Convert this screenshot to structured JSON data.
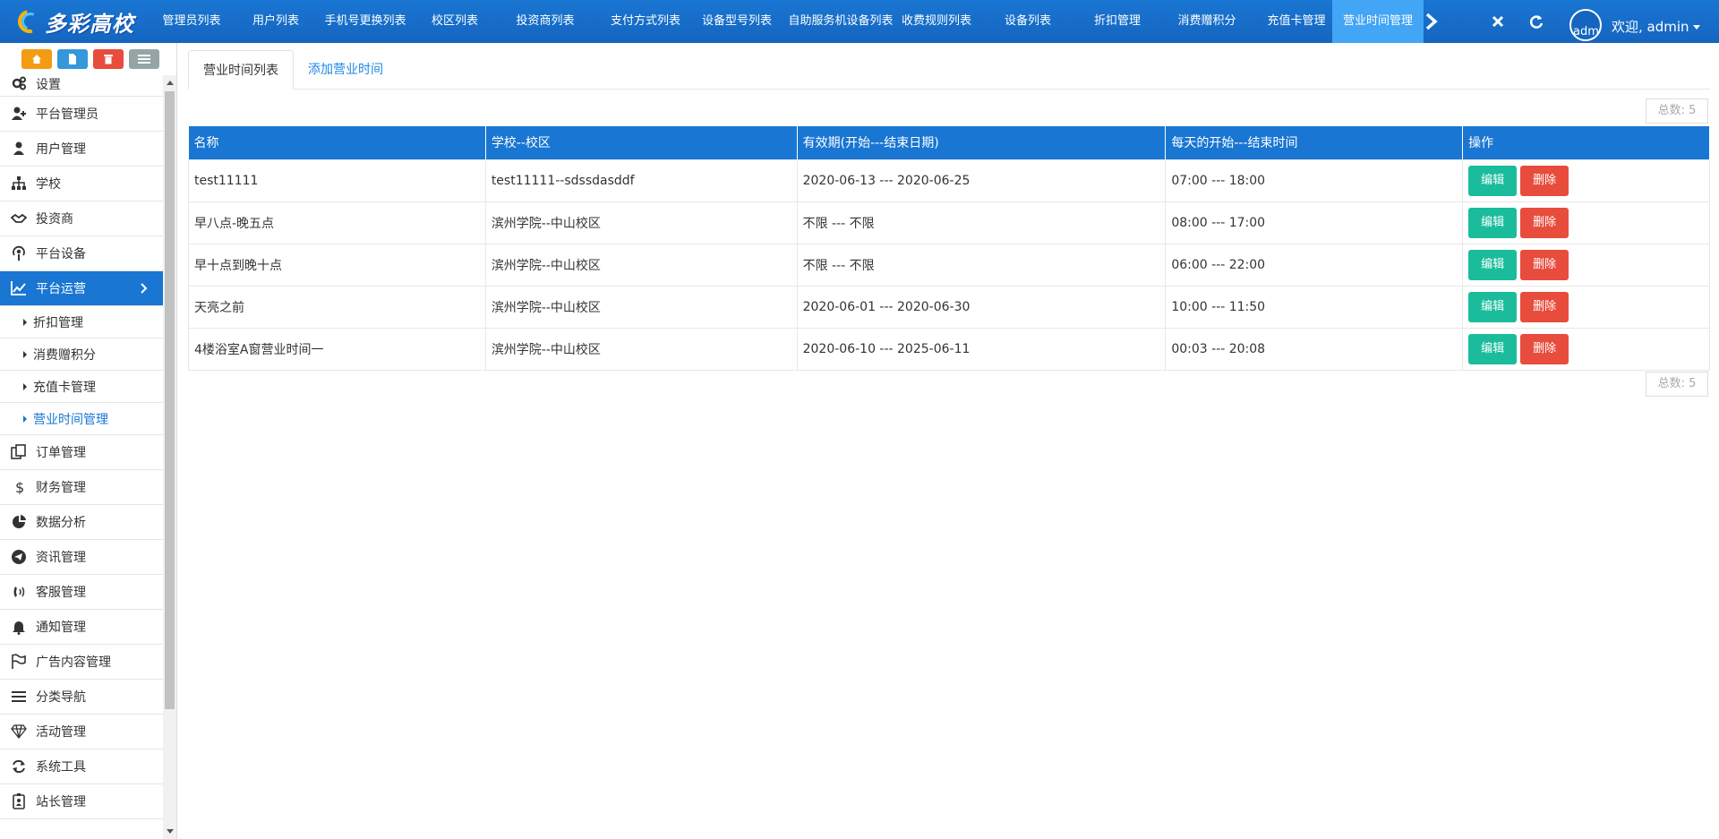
{
  "header": {
    "logo_text": "多彩高校",
    "nav": [
      {
        "label": "管理员列表",
        "w": 108
      },
      {
        "label": "用户列表",
        "w": 80
      },
      {
        "label": "手机号更换列表",
        "w": 120
      },
      {
        "label": "校区列表",
        "w": 80
      },
      {
        "label": "投资商列表",
        "w": 122
      },
      {
        "label": "支付方式列表",
        "w": 102
      },
      {
        "label": "设备型号列表",
        "w": 102
      },
      {
        "label": "自助服务机设备列表",
        "w": 130
      },
      {
        "label": "收费规则列表",
        "w": 84
      },
      {
        "label": "设备列表",
        "w": 120
      },
      {
        "label": "折扣管理",
        "w": 80
      },
      {
        "label": "消费赠积分",
        "w": 120
      },
      {
        "label": "充值卡管理",
        "w": 80
      },
      {
        "label": "营业时间管理",
        "w": 102,
        "active": true
      }
    ],
    "avatar_alt": "admin",
    "welcome": "欢迎, admin"
  },
  "sidebar": {
    "items": [
      {
        "label": "设置",
        "icon": "cogs-icon"
      },
      {
        "label": "平台管理员",
        "icon": "user-plus-icon"
      },
      {
        "label": "用户管理",
        "icon": "user-icon"
      },
      {
        "label": "学校",
        "icon": "sitemap-icon"
      },
      {
        "label": "投资商",
        "icon": "handshake-icon"
      },
      {
        "label": "平台设备",
        "icon": "podcast-icon"
      },
      {
        "label": "平台运营",
        "icon": "line-chart-icon",
        "active": true
      },
      {
        "label": "订单管理",
        "icon": "copy-icon"
      },
      {
        "label": "财务管理",
        "icon": "dollar-icon"
      },
      {
        "label": "数据分析",
        "icon": "pie-chart-icon"
      },
      {
        "label": "资讯管理",
        "icon": "telegram-icon"
      },
      {
        "label": "客服管理",
        "icon": "volume-control-phone-icon"
      },
      {
        "label": "通知管理",
        "icon": "bell-icon"
      },
      {
        "label": "广告内容管理",
        "icon": "flag-icon"
      },
      {
        "label": "分类导航",
        "icon": "bars-icon"
      },
      {
        "label": "活动管理",
        "icon": "diamond-icon"
      },
      {
        "label": "系统工具",
        "icon": "refresh-icon"
      },
      {
        "label": "站长管理",
        "icon": "id-badge-icon"
      }
    ],
    "subitems": [
      {
        "label": "折扣管理"
      },
      {
        "label": "消费赠积分"
      },
      {
        "label": "充值卡管理"
      },
      {
        "label": "营业时间管理",
        "active": true
      }
    ]
  },
  "content": {
    "tabs": {
      "list": "营业时间列表",
      "add": "添加营业时间"
    },
    "total": "总数: 5",
    "columns": [
      "名称",
      "学校--校区",
      "有效期(开始---结束日期)",
      "每天的开始---结束时间",
      "操作"
    ],
    "rows": [
      [
        "test11111",
        "test11111--sdssdasddf",
        "2020-06-13 --- 2020-06-25",
        "07:00 --- 18:00"
      ],
      [
        "早八点-晚五点",
        "滨州学院--中山校区",
        "不限 --- 不限",
        "08:00 --- 17:00"
      ],
      [
        "早十点到晚十点",
        "滨州学院--中山校区",
        "不限 --- 不限",
        "06:00 --- 22:00"
      ],
      [
        "天亮之前",
        "滨州学院--中山校区",
        "2020-06-01 --- 2020-06-30",
        "10:00 --- 11:50"
      ],
      [
        "4楼浴室A窗营业时间一",
        "滨州学院--中山校区",
        "2020-06-10 --- 2025-06-11",
        "00:03 --- 20:08"
      ]
    ],
    "edit_label": "编辑",
    "delete_label": "删除"
  },
  "colors": {
    "primary": "#1976d2",
    "edit": "#1abc9c",
    "delete": "#e74c3c",
    "orange": "#f39c12",
    "blue": "#3498db",
    "gray": "#95a5a6"
  }
}
